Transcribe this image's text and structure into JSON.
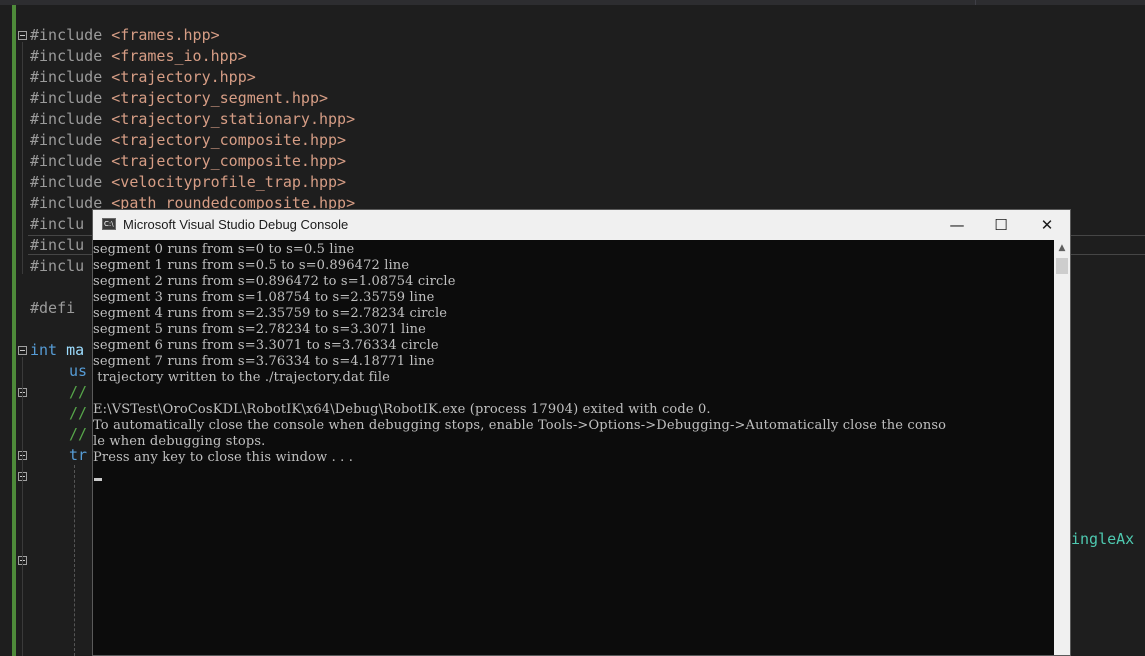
{
  "editor": {
    "lines": [
      {
        "pre": "#include ",
        "arg": "<frames.hpp>"
      },
      {
        "pre": "#include ",
        "arg": "<frames_io.hpp>"
      },
      {
        "pre": "#include ",
        "arg": "<trajectory.hpp>"
      },
      {
        "pre": "#include ",
        "arg": "<trajectory_segment.hpp>"
      },
      {
        "pre": "#include ",
        "arg": "<trajectory_stationary.hpp>"
      },
      {
        "pre": "#include ",
        "arg": "<trajectory_composite.hpp>"
      },
      {
        "pre": "#include ",
        "arg": "<trajectory_composite.hpp>"
      },
      {
        "pre": "#include ",
        "arg": "<velocityprofile_trap.hpp>"
      },
      {
        "pre": "#include ",
        "arg": "<path_roundedcomposite.hpp>"
      },
      {
        "pre": "#inclu",
        "arg": ""
      },
      {
        "pre": "#inclu",
        "arg": ""
      },
      {
        "pre": "#inclu",
        "arg": ""
      },
      {
        "pre": "#defi",
        "arg": ""
      }
    ],
    "main_kw": "int",
    "main_name": "ma",
    "using_frag": "us",
    "comment_frag": "//",
    "try_frag": "tr",
    "right_frag": "ingleAx"
  },
  "console": {
    "title": "Microsoft Visual Studio Debug Console",
    "icon_text": "C:\\",
    "buttons": {
      "minimize": "—",
      "maximize": "☐",
      "close": "✕"
    },
    "lines": [
      "segment 0 runs from s=0 to s=0.5 line",
      "segment 1 runs from s=0.5 to s=0.896472 line",
      "segment 2 runs from s=0.896472 to s=1.08754 circle",
      "segment 3 runs from s=1.08754 to s=2.35759 line",
      "segment 4 runs from s=2.35759 to s=2.78234 circle",
      "segment 5 runs from s=2.78234 to s=3.3071 line",
      "segment 6 runs from s=3.3071 to s=3.76334 circle",
      "segment 7 runs from s=3.76334 to s=4.18771 line",
      " trajectory written to the ./trajectory.dat file",
      "",
      "E:\\VSTest\\OroCosKDL\\RobotIK\\x64\\Debug\\RobotIK.exe (process 17904) exited with code 0.",
      "To automatically close the console when debugging stops, enable Tools->Options->Debugging->Automatically close the conso",
      "le when debugging stops.",
      "Press any key to close this window . . ."
    ],
    "scroll_up": "▲"
  }
}
